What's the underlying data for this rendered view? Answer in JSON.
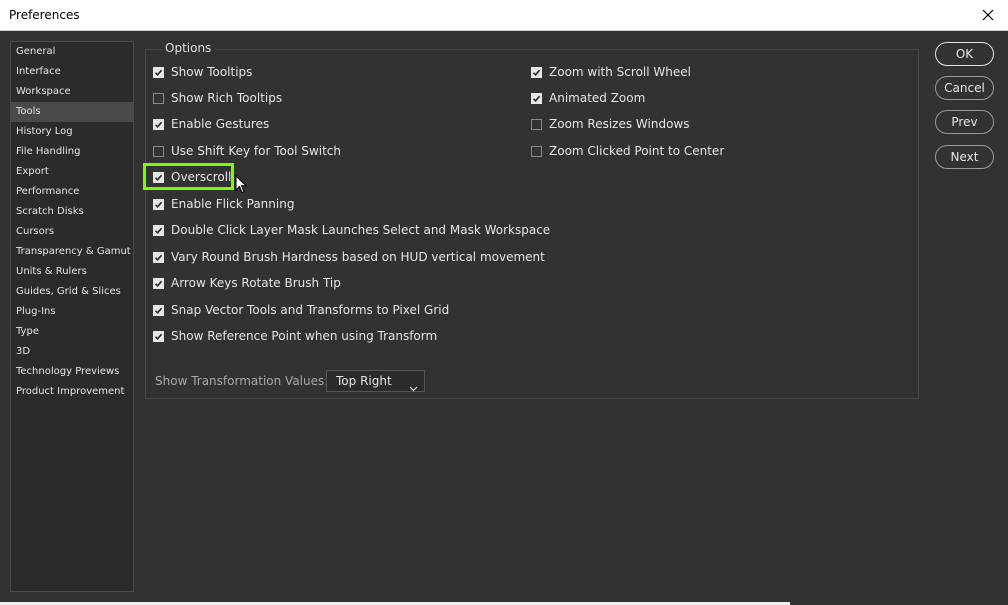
{
  "window": {
    "title": "Preferences"
  },
  "sidebar": {
    "items": [
      {
        "label": "General",
        "selected": false
      },
      {
        "label": "Interface",
        "selected": false
      },
      {
        "label": "Workspace",
        "selected": false
      },
      {
        "label": "Tools",
        "selected": true
      },
      {
        "label": "History Log",
        "selected": false
      },
      {
        "label": "File Handling",
        "selected": false
      },
      {
        "label": "Export",
        "selected": false
      },
      {
        "label": "Performance",
        "selected": false
      },
      {
        "label": "Scratch Disks",
        "selected": false
      },
      {
        "label": "Cursors",
        "selected": false
      },
      {
        "label": "Transparency & Gamut",
        "selected": false
      },
      {
        "label": "Units & Rulers",
        "selected": false
      },
      {
        "label": "Guides, Grid & Slices",
        "selected": false
      },
      {
        "label": "Plug-Ins",
        "selected": false
      },
      {
        "label": "Type",
        "selected": false
      },
      {
        "label": "3D",
        "selected": false
      },
      {
        "label": "Technology Previews",
        "selected": false
      },
      {
        "label": "Product Improvement",
        "selected": false
      }
    ]
  },
  "options": {
    "legend": "Options",
    "left": [
      {
        "label": "Show Tooltips",
        "checked": true
      },
      {
        "label": "Show Rich Tooltips",
        "checked": false
      },
      {
        "label": "Enable Gestures",
        "checked": true
      },
      {
        "label": "Use Shift Key for Tool Switch",
        "checked": false
      },
      {
        "label": "Overscroll",
        "checked": true
      },
      {
        "label": "Enable Flick Panning",
        "checked": true
      },
      {
        "label": "Double Click Layer Mask Launches Select and Mask Workspace",
        "checked": true
      },
      {
        "label": "Vary Round Brush Hardness based on HUD vertical movement",
        "checked": true
      },
      {
        "label": "Arrow Keys Rotate Brush Tip",
        "checked": true
      },
      {
        "label": "Snap Vector Tools and Transforms to Pixel Grid",
        "checked": true
      },
      {
        "label": "Show Reference Point when using Transform",
        "checked": true
      }
    ],
    "right": [
      {
        "label": "Zoom with Scroll Wheel",
        "checked": true
      },
      {
        "label": "Animated Zoom",
        "checked": true
      },
      {
        "label": "Zoom Resizes Windows",
        "checked": false
      },
      {
        "label": "Zoom Clicked Point to Center",
        "checked": false
      }
    ],
    "transformation_values_label": "Show Transformation Values:",
    "transformation_values_selected": "Top Right"
  },
  "buttons": {
    "ok": "OK",
    "cancel": "Cancel",
    "prev": "Prev",
    "next": "Next"
  },
  "colors": {
    "background": "#323232",
    "highlight": "#7cfc00",
    "text": "#e6e6e6"
  }
}
